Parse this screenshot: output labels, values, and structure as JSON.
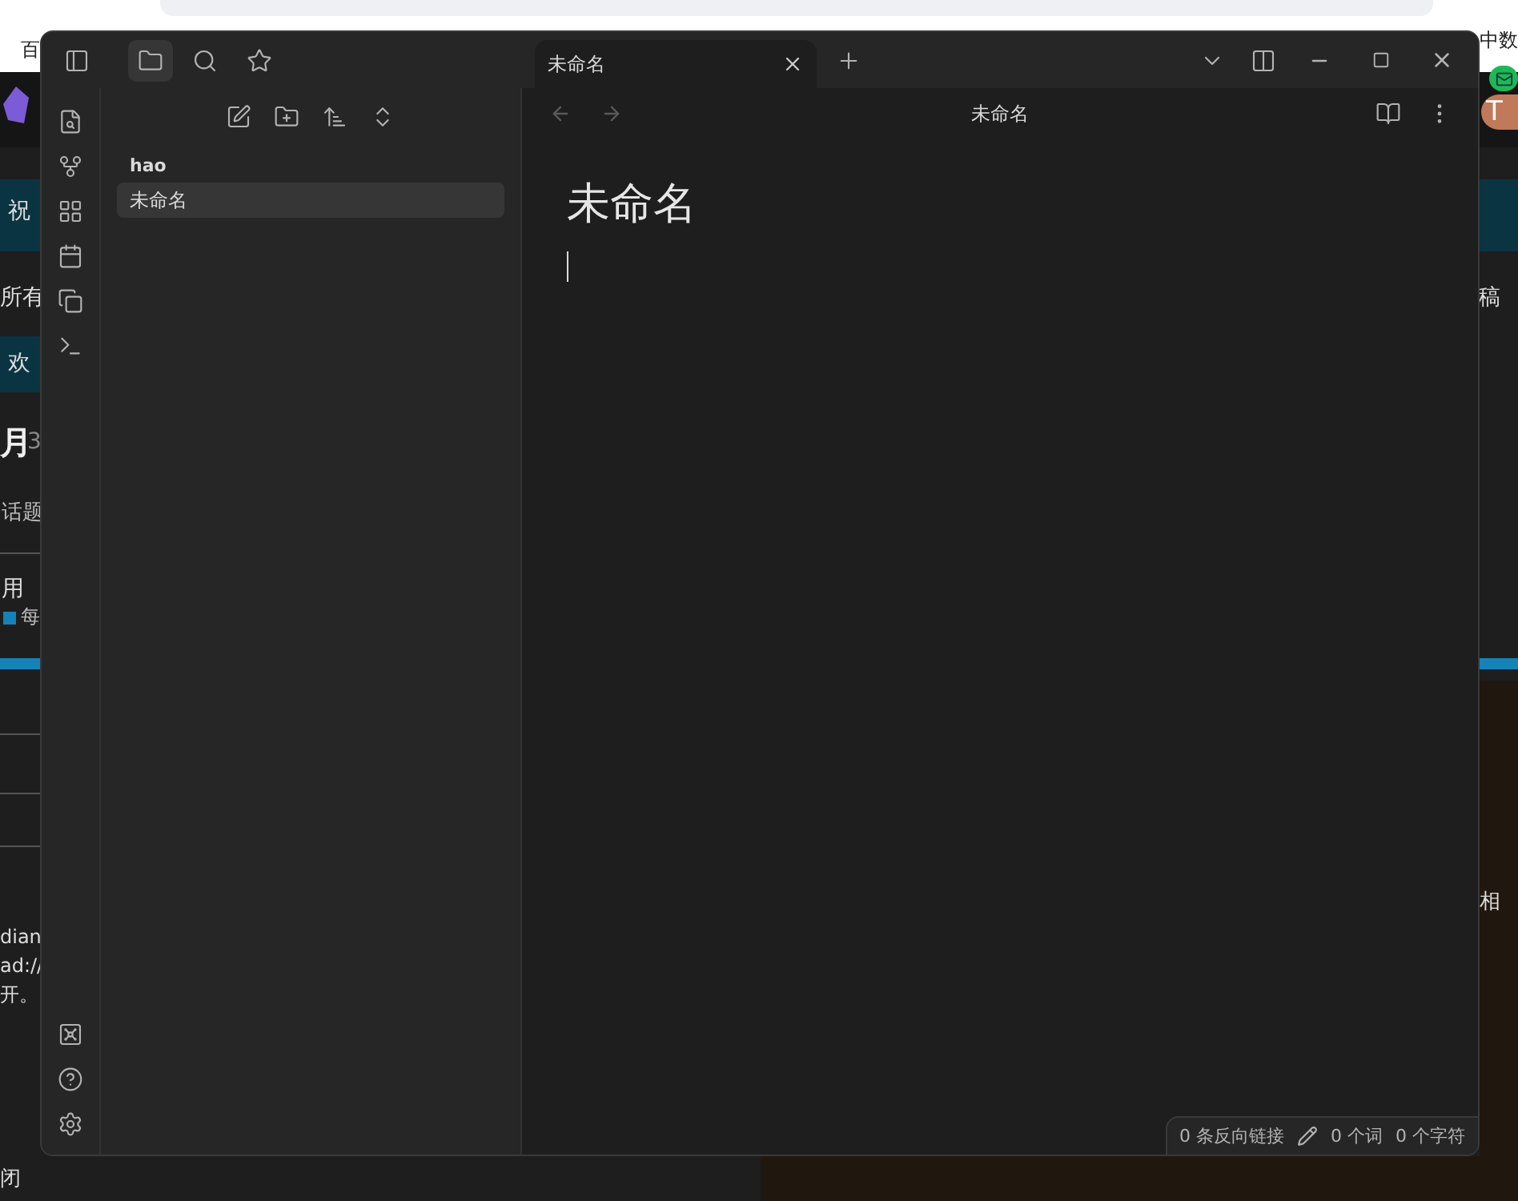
{
  "background_page": {
    "left_texts": [
      "百",
      "祝",
      "所有",
      "欢",
      "月",
      "3",
      "话题",
      "用",
      "每",
      "dian",
      "ad://",
      "开。",
      "闭"
    ],
    "right_texts": [
      "中数",
      "稿",
      "相"
    ],
    "avatar": "T"
  },
  "window": {
    "sidebar_tabs": [
      {
        "kind": "folder",
        "selected": true
      },
      {
        "kind": "search",
        "selected": false
      },
      {
        "kind": "star",
        "selected": false
      }
    ],
    "tabs": [
      {
        "title": "未命名",
        "selected": true
      }
    ],
    "file_tree": {
      "folder": "hao",
      "files": [
        {
          "name": "未命名",
          "selected": true
        }
      ]
    },
    "editor": {
      "header_title": "未命名",
      "heading": "未命名",
      "back_disabled": true,
      "forward_disabled": true
    },
    "status_bar": {
      "backlinks": "0 条反向链接",
      "words": "0 个词",
      "chars": "0 个字符"
    }
  }
}
